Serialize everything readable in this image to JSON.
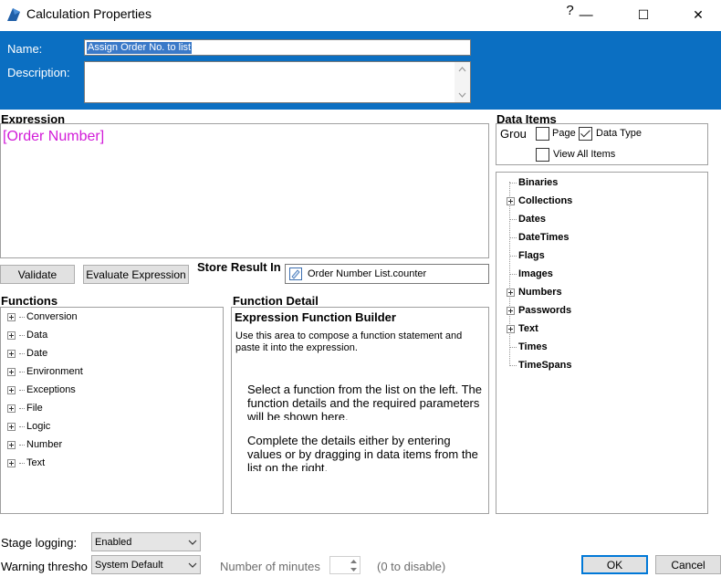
{
  "window": {
    "title": "Calculation Properties",
    "help_glyph": "?",
    "minimize_glyph": "—",
    "maximize_glyph": "☐",
    "close_glyph": "✕"
  },
  "header": {
    "name_label": "Name:",
    "name_value": "Assign Order No. to list",
    "description_label": "Description:",
    "description_value": ""
  },
  "expression": {
    "title": "Expression",
    "value": "[Order Number]",
    "validate_label": "Validate",
    "evaluate_label": "Evaluate Expression",
    "store_result_label": "Store Result In",
    "store_result_value": "Order Number List.counter"
  },
  "functions": {
    "title": "Functions",
    "items": [
      "Conversion",
      "Data",
      "Date",
      "Environment",
      "Exceptions",
      "File",
      "Logic",
      "Number",
      "Text"
    ]
  },
  "function_detail": {
    "title": "Function Detail",
    "heading": "Expression Function Builder",
    "intro": "Use this area to compose a function statement and paste it into the expression.",
    "paragraph1": "Select a function from the list on the left. The function details and the required parameters will be shown here.",
    "paragraph2": "Complete the details either by entering values or by dragging in data items from the list on the right."
  },
  "data_items": {
    "title": "Data Items",
    "group_label": "Grou",
    "page_label": "Page",
    "page_checked": false,
    "data_type_label": "Data Type",
    "data_type_checked": true,
    "view_all_label": "View All Items",
    "view_all_checked": false,
    "tree": [
      {
        "label": "Binaries",
        "expandable": false
      },
      {
        "label": "Collections",
        "expandable": true
      },
      {
        "label": "Dates",
        "expandable": false
      },
      {
        "label": "DateTimes",
        "expandable": false
      },
      {
        "label": "Flags",
        "expandable": false
      },
      {
        "label": "Images",
        "expandable": false
      },
      {
        "label": "Numbers",
        "expandable": true
      },
      {
        "label": "Passwords",
        "expandable": true
      },
      {
        "label": "Text",
        "expandable": true
      },
      {
        "label": "Times",
        "expandable": false
      },
      {
        "label": "TimeSpans",
        "expandable": false
      }
    ]
  },
  "footer": {
    "stage_logging_label": "Stage logging:",
    "stage_logging_value": "Enabled",
    "warning_label": "Warning thresho",
    "warning_value": "System Default",
    "minutes_label": "Number of minutes",
    "minutes_value": "",
    "disable_hint": "(0 to disable)",
    "ok_label": "OK",
    "cancel_label": "Cancel"
  },
  "colors": {
    "header_blue": "#0b6fc2",
    "expression_magenta": "#d21cd8",
    "button_gray": "#e1e1e1"
  }
}
